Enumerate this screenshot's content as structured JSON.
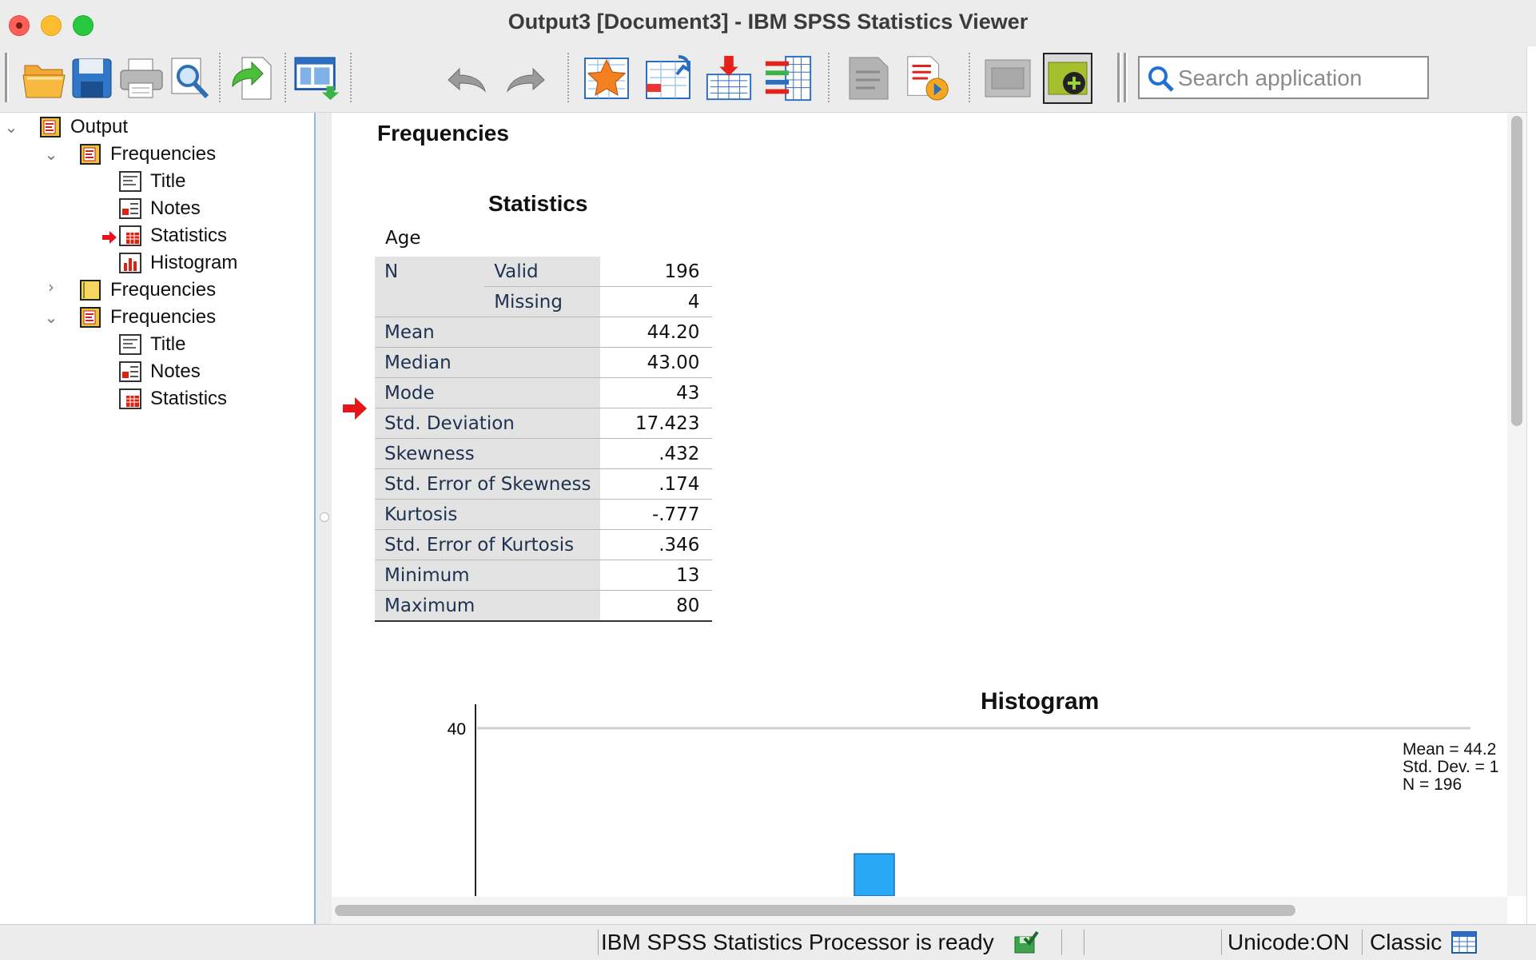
{
  "window": {
    "title": "Output3 [Document3] - IBM SPSS Statistics Viewer"
  },
  "toolbar": {
    "buttons": [
      "open-icon",
      "save-icon",
      "print-icon",
      "print-preview-icon",
      "export-icon",
      "recall-dialog-icon",
      "undo-icon",
      "redo-icon",
      "goto-data-icon",
      "goto-case-icon",
      "goto-variable-icon",
      "variables-icon",
      "designate-window-icon",
      "run-script-icon",
      "show-all-icon",
      "insert-output-icon"
    ],
    "search_placeholder": "Search application"
  },
  "tree": {
    "root": "Output",
    "items": [
      {
        "label": "Frequencies",
        "expanded": true
      },
      {
        "label": "Title"
      },
      {
        "label": "Notes"
      },
      {
        "label": "Statistics",
        "current": true
      },
      {
        "label": "Histogram"
      },
      {
        "label": "Frequencies",
        "expanded": false
      },
      {
        "label": "Frequencies",
        "expanded": true
      },
      {
        "label": "Title"
      },
      {
        "label": "Notes"
      },
      {
        "label": "Statistics"
      }
    ]
  },
  "content": {
    "section_title": "Frequencies",
    "table_title": "Statistics",
    "variable": "Age",
    "rows": [
      {
        "label": "N",
        "sub": "Valid",
        "value": "196"
      },
      {
        "label": "",
        "sub": "Missing",
        "value": "4"
      },
      {
        "label": "Mean",
        "value": "44.20"
      },
      {
        "label": "Median",
        "value": "43.00"
      },
      {
        "label": "Mode",
        "value": "43"
      },
      {
        "label": "Std. Deviation",
        "value": "17.423"
      },
      {
        "label": "Skewness",
        "value": ".432"
      },
      {
        "label": "Std. Error of Skewness",
        "value": ".174"
      },
      {
        "label": "Kurtosis",
        "value": "-.777"
      },
      {
        "label": "Std. Error of Kurtosis",
        "value": ".346"
      },
      {
        "label": "Minimum",
        "value": "13"
      },
      {
        "label": "Maximum",
        "value": "80"
      }
    ],
    "histogram": {
      "title": "Histogram",
      "y_tick": "40",
      "legend": [
        "Mean = 44.2",
        "Std. Dev. = 1",
        "N = 196"
      ],
      "bar_color": "#29a8f5"
    }
  },
  "chart_data": {
    "type": "bar",
    "title": "Histogram",
    "xlabel": "",
    "ylabel": "",
    "yticks": [
      40
    ],
    "visible_bars": [
      {
        "value": 16
      }
    ],
    "annotations": [
      "Mean = 44.2",
      "Std. Dev. = 1",
      "N = 196"
    ]
  },
  "status": {
    "message": "IBM SPSS Statistics Processor is ready",
    "unicode": "Unicode:ON",
    "mode": "Classic"
  },
  "colors": {
    "accent": "#29a8f5",
    "arrow": "#e8141b",
    "tree_border": "#8fb8e0"
  }
}
